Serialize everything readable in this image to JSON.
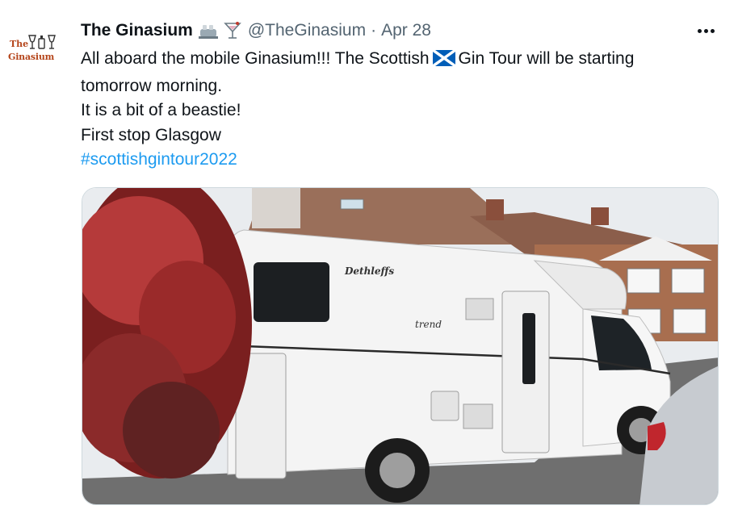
{
  "tweet": {
    "avatar_alt": "The Ginasium",
    "avatar_text_line1": "The",
    "avatar_text_line2": "Ginasium",
    "display_name": "The Ginasium",
    "header_icons": [
      "bottles-icon",
      "cocktail-glass-icon"
    ],
    "handle": "@TheGinasium",
    "separator": "·",
    "date": "Apr 28",
    "text_parts": {
      "line1_before_flag": "All aboard the mobile Ginasium!!! The Scottish",
      "flag_icon": "scotland-flag-icon",
      "line1_after_flag": "Gin Tour will be starting",
      "line2": "tomorrow morning.",
      "line3": "It is a bit of a beastie!",
      "line4": "First stop Glasgow",
      "hashtag": "#scottishgintour2022"
    },
    "media": {
      "description_icon": "photo",
      "motorhome_brand": "Dethleffs",
      "motorhome_model": "trend"
    }
  },
  "colors": {
    "text": "#0f1419",
    "secondary": "#536471",
    "link": "#1d9bf0",
    "logo": "#b5451b",
    "flag_blue": "#005eb8"
  }
}
